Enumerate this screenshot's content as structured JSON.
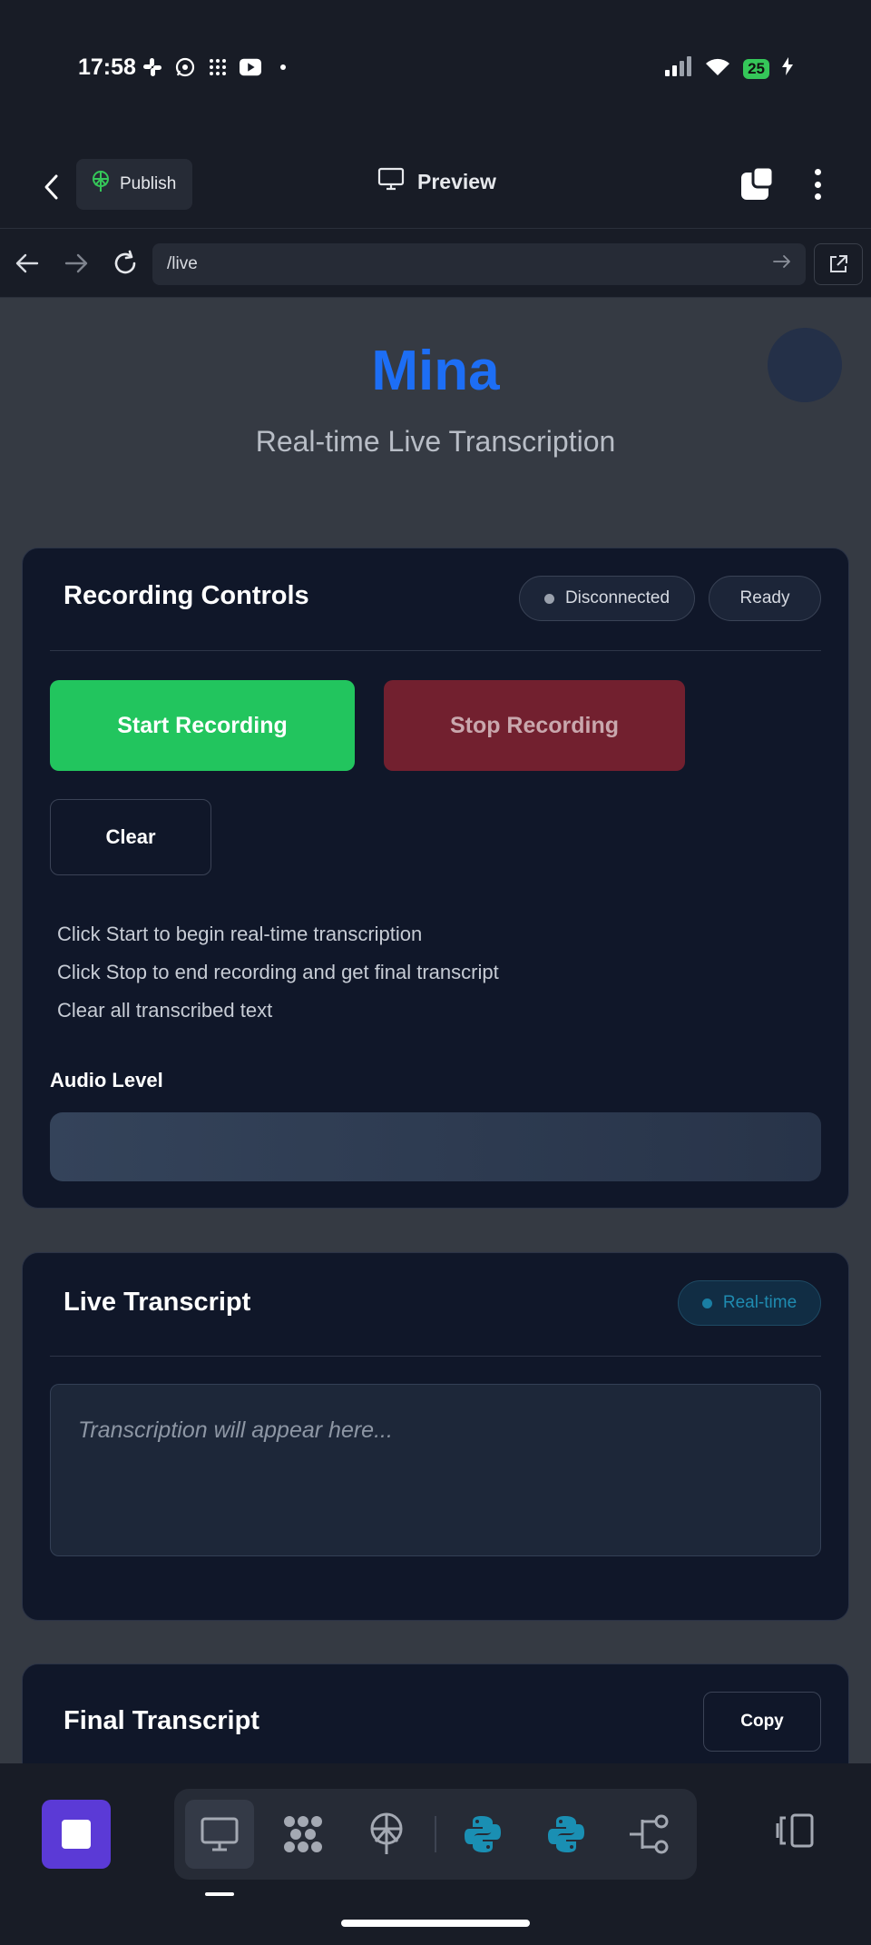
{
  "status_bar": {
    "time": "17:58",
    "battery": "25"
  },
  "app_bar": {
    "publish_label": "Publish",
    "title": "Preview"
  },
  "browser": {
    "url": "/live"
  },
  "page": {
    "brand": "Mina",
    "subtitle": "Real-time Live Transcription"
  },
  "controls": {
    "title": "Recording Controls",
    "connection_status": "Disconnected",
    "state_status": "Ready",
    "start_label": "Start Recording",
    "stop_label": "Stop Recording",
    "clear_label": "Clear",
    "hints": [
      "Click Start to begin real-time transcription",
      "Click Stop to end recording and get final transcript",
      "Clear all transcribed text"
    ],
    "audio_level_label": "Audio Level",
    "audio_level": 0
  },
  "live": {
    "title": "Live Transcript",
    "badge": "Real-time",
    "placeholder": "Transcription will appear here..."
  },
  "final": {
    "title": "Final Transcript",
    "copy_label": "Copy"
  },
  "colors": {
    "accent": "#1d6ef5",
    "start": "#22c55e",
    "stop": "#72202f",
    "card": "#101729",
    "page_bg": "#353a43"
  },
  "dock": {
    "tools": [
      "monitor-icon",
      "network-icon",
      "deploy-icon",
      "python-icon",
      "python-icon",
      "git-branch-icon"
    ]
  }
}
